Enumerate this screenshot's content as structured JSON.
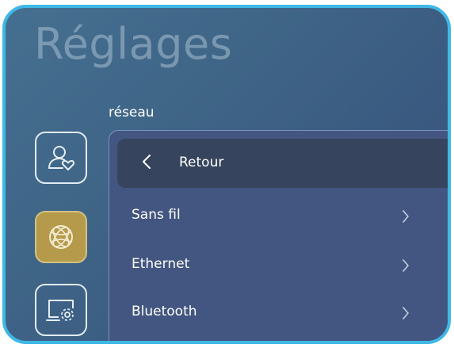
{
  "header": {
    "title": "Réglages"
  },
  "section": {
    "label": "réseau"
  },
  "sidebar": {
    "items": [
      {
        "name": "account",
        "icon": "user-heart-icon",
        "active": false
      },
      {
        "name": "network",
        "icon": "globe-icon",
        "active": true
      },
      {
        "name": "system",
        "icon": "monitor-gear-icon",
        "active": false
      }
    ]
  },
  "menu": {
    "back_label": "Retour",
    "items": [
      {
        "label": "Sans fil"
      },
      {
        "label": "Ethernet"
      },
      {
        "label": "Bluetooth"
      }
    ]
  },
  "colors": {
    "frame_border": "#3fb8e6",
    "background": "#3f6587",
    "panel": "#435681",
    "back_row": "#36445d",
    "active_icon": "#b49a4a"
  }
}
